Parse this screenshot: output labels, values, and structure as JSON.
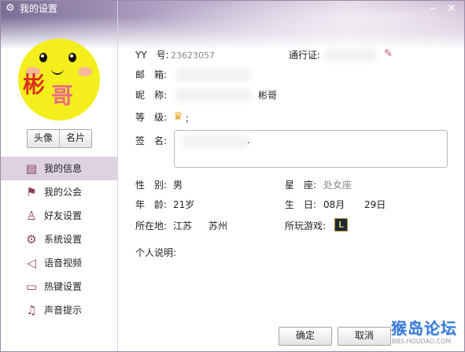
{
  "window": {
    "title": "我的设置"
  },
  "sidebar": {
    "avatar_text": [
      "彬",
      "哥"
    ],
    "avatar_buttons": [
      "头像",
      "名片"
    ],
    "items": [
      {
        "label": "我的信息",
        "icon": "profile-icon"
      },
      {
        "label": "我的公会",
        "icon": "flag-icon"
      },
      {
        "label": "好友设置",
        "icon": "person-icon"
      },
      {
        "label": "系统设置",
        "icon": "gear-icon"
      },
      {
        "label": "语音视频",
        "icon": "speaker-icon"
      },
      {
        "label": "热键设置",
        "icon": "keyboard-icon"
      },
      {
        "label": "声音提示",
        "icon": "music-note-icon"
      }
    ]
  },
  "info": {
    "yy_label": "YY　号:",
    "yy_value": "23623057",
    "passport_label": "通行证:",
    "email_label": "邮　箱:",
    "nickname_label": "昵　称:",
    "nickname_value": "彬哥",
    "level_label": "等　级:",
    "level_suffix": ";",
    "signature_label": "签　名:",
    "signature_value": ".",
    "gender_label": "性　别:",
    "gender_value": "男",
    "zodiac_label": "星　座:",
    "zodiac_value": "处女座",
    "age_label": "年　龄:",
    "age_value": "21岁",
    "birthday_label": "生　日:",
    "birth_month": "08月",
    "birth_day": "29日",
    "location_label": "所在地:",
    "province": "江苏",
    "city": "苏州",
    "games_label": "所玩游戏:",
    "game_icon_letter": "L",
    "intro_label": "个人说明:"
  },
  "footer": {
    "ok_label": "确定",
    "cancel_label": "取消"
  },
  "watermark": {
    "line1": "猴岛论坛",
    "line2": "BBS.HOUDAO.COM"
  },
  "colors": {
    "accent": "#8b3f64",
    "nav_active": "#dcd2e0",
    "titlebar": "#7b6e95"
  }
}
